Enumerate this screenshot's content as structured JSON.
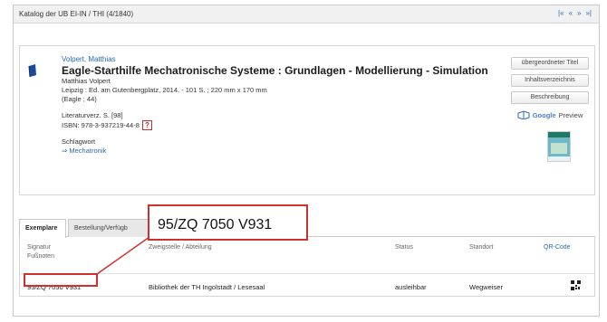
{
  "catalog": {
    "title": "Katalog der UB EI-IN / THI (4/1840)",
    "pager": [
      "|«",
      "«",
      "»",
      "»|"
    ]
  },
  "record": {
    "author": "Volpert, Matthias",
    "title": "Eagle-Starthilfe Mechatronische Systeme : Grundlagen - Modellierung - Simulation",
    "statement": "Matthias Volpert",
    "imprint": "Leipzig : Ed. am Gutenbergplatz, 2014. - 101 S. ; 220 mm x 170 mm",
    "series": "(Eagle ; 44)",
    "notes": "Literaturverz. S. [98]",
    "isbn": "ISBN: 978-3-937219-44-8",
    "help_mark": "?",
    "subject_label": "Schlagwort",
    "subject_link": "⇒ Mechatronik"
  },
  "side_buttons": {
    "parent_title": "übergeordneter Titel",
    "toc": "Inhaltsverzeichnis",
    "description": "Beschreibung",
    "google_brand": "Google",
    "preview": "Preview"
  },
  "tabs": [
    {
      "label": "Exemplare",
      "active": true
    },
    {
      "label": "Bestellung/Verfügb",
      "active": false
    }
  ],
  "table": {
    "headers": {
      "signature": [
        "Signatur",
        "Fußnoten"
      ],
      "branch": "Zweigstelle / Abteilung",
      "status": "Status",
      "location": "Standort",
      "qr": "QR-Code"
    },
    "rows": [
      {
        "signature": "95/ZQ 7050 V931",
        "branch": "Bibliothek der TH Ingolstadt / Lesesaal",
        "status": "ausleihbar",
        "location": "Wegweiser"
      }
    ]
  },
  "callout": {
    "text": "95/ZQ 7050 V931",
    "color": "#d0312d"
  },
  "colors": {
    "link": "#2a6ab7",
    "highlight": "#d0312d"
  }
}
